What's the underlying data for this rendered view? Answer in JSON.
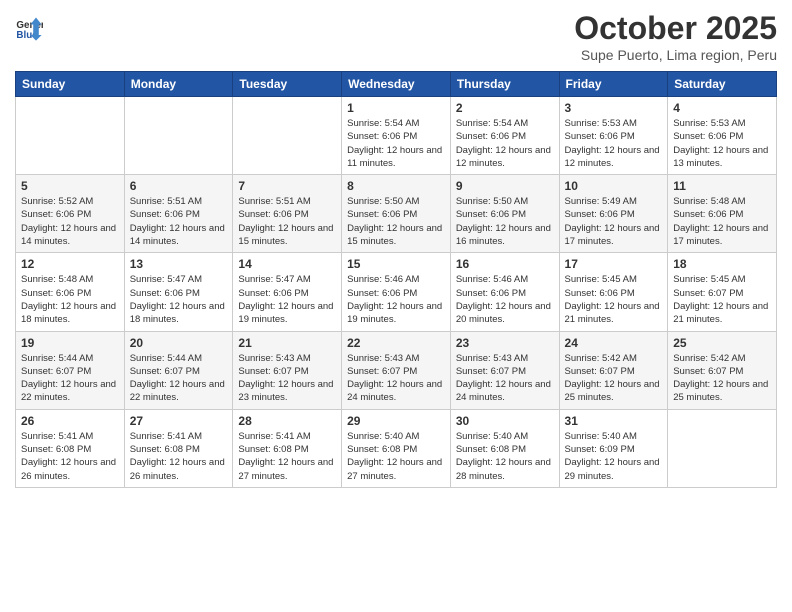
{
  "header": {
    "logo_line1": "General",
    "logo_line2": "Blue",
    "month": "October 2025",
    "location": "Supe Puerto, Lima region, Peru"
  },
  "weekdays": [
    "Sunday",
    "Monday",
    "Tuesday",
    "Wednesday",
    "Thursday",
    "Friday",
    "Saturday"
  ],
  "weeks": [
    [
      {
        "day": "",
        "info": ""
      },
      {
        "day": "",
        "info": ""
      },
      {
        "day": "",
        "info": ""
      },
      {
        "day": "1",
        "info": "Sunrise: 5:54 AM\nSunset: 6:06 PM\nDaylight: 12 hours\nand 11 minutes."
      },
      {
        "day": "2",
        "info": "Sunrise: 5:54 AM\nSunset: 6:06 PM\nDaylight: 12 hours\nand 12 minutes."
      },
      {
        "day": "3",
        "info": "Sunrise: 5:53 AM\nSunset: 6:06 PM\nDaylight: 12 hours\nand 12 minutes."
      },
      {
        "day": "4",
        "info": "Sunrise: 5:53 AM\nSunset: 6:06 PM\nDaylight: 12 hours\nand 13 minutes."
      }
    ],
    [
      {
        "day": "5",
        "info": "Sunrise: 5:52 AM\nSunset: 6:06 PM\nDaylight: 12 hours\nand 14 minutes."
      },
      {
        "day": "6",
        "info": "Sunrise: 5:51 AM\nSunset: 6:06 PM\nDaylight: 12 hours\nand 14 minutes."
      },
      {
        "day": "7",
        "info": "Sunrise: 5:51 AM\nSunset: 6:06 PM\nDaylight: 12 hours\nand 15 minutes."
      },
      {
        "day": "8",
        "info": "Sunrise: 5:50 AM\nSunset: 6:06 PM\nDaylight: 12 hours\nand 15 minutes."
      },
      {
        "day": "9",
        "info": "Sunrise: 5:50 AM\nSunset: 6:06 PM\nDaylight: 12 hours\nand 16 minutes."
      },
      {
        "day": "10",
        "info": "Sunrise: 5:49 AM\nSunset: 6:06 PM\nDaylight: 12 hours\nand 17 minutes."
      },
      {
        "day": "11",
        "info": "Sunrise: 5:48 AM\nSunset: 6:06 PM\nDaylight: 12 hours\nand 17 minutes."
      }
    ],
    [
      {
        "day": "12",
        "info": "Sunrise: 5:48 AM\nSunset: 6:06 PM\nDaylight: 12 hours\nand 18 minutes."
      },
      {
        "day": "13",
        "info": "Sunrise: 5:47 AM\nSunset: 6:06 PM\nDaylight: 12 hours\nand 18 minutes."
      },
      {
        "day": "14",
        "info": "Sunrise: 5:47 AM\nSunset: 6:06 PM\nDaylight: 12 hours\nand 19 minutes."
      },
      {
        "day": "15",
        "info": "Sunrise: 5:46 AM\nSunset: 6:06 PM\nDaylight: 12 hours\nand 19 minutes."
      },
      {
        "day": "16",
        "info": "Sunrise: 5:46 AM\nSunset: 6:06 PM\nDaylight: 12 hours\nand 20 minutes."
      },
      {
        "day": "17",
        "info": "Sunrise: 5:45 AM\nSunset: 6:06 PM\nDaylight: 12 hours\nand 21 minutes."
      },
      {
        "day": "18",
        "info": "Sunrise: 5:45 AM\nSunset: 6:07 PM\nDaylight: 12 hours\nand 21 minutes."
      }
    ],
    [
      {
        "day": "19",
        "info": "Sunrise: 5:44 AM\nSunset: 6:07 PM\nDaylight: 12 hours\nand 22 minutes."
      },
      {
        "day": "20",
        "info": "Sunrise: 5:44 AM\nSunset: 6:07 PM\nDaylight: 12 hours\nand 22 minutes."
      },
      {
        "day": "21",
        "info": "Sunrise: 5:43 AM\nSunset: 6:07 PM\nDaylight: 12 hours\nand 23 minutes."
      },
      {
        "day": "22",
        "info": "Sunrise: 5:43 AM\nSunset: 6:07 PM\nDaylight: 12 hours\nand 24 minutes."
      },
      {
        "day": "23",
        "info": "Sunrise: 5:43 AM\nSunset: 6:07 PM\nDaylight: 12 hours\nand 24 minutes."
      },
      {
        "day": "24",
        "info": "Sunrise: 5:42 AM\nSunset: 6:07 PM\nDaylight: 12 hours\nand 25 minutes."
      },
      {
        "day": "25",
        "info": "Sunrise: 5:42 AM\nSunset: 6:07 PM\nDaylight: 12 hours\nand 25 minutes."
      }
    ],
    [
      {
        "day": "26",
        "info": "Sunrise: 5:41 AM\nSunset: 6:08 PM\nDaylight: 12 hours\nand 26 minutes."
      },
      {
        "day": "27",
        "info": "Sunrise: 5:41 AM\nSunset: 6:08 PM\nDaylight: 12 hours\nand 26 minutes."
      },
      {
        "day": "28",
        "info": "Sunrise: 5:41 AM\nSunset: 6:08 PM\nDaylight: 12 hours\nand 27 minutes."
      },
      {
        "day": "29",
        "info": "Sunrise: 5:40 AM\nSunset: 6:08 PM\nDaylight: 12 hours\nand 27 minutes."
      },
      {
        "day": "30",
        "info": "Sunrise: 5:40 AM\nSunset: 6:08 PM\nDaylight: 12 hours\nand 28 minutes."
      },
      {
        "day": "31",
        "info": "Sunrise: 5:40 AM\nSunset: 6:09 PM\nDaylight: 12 hours\nand 29 minutes."
      },
      {
        "day": "",
        "info": ""
      }
    ]
  ]
}
